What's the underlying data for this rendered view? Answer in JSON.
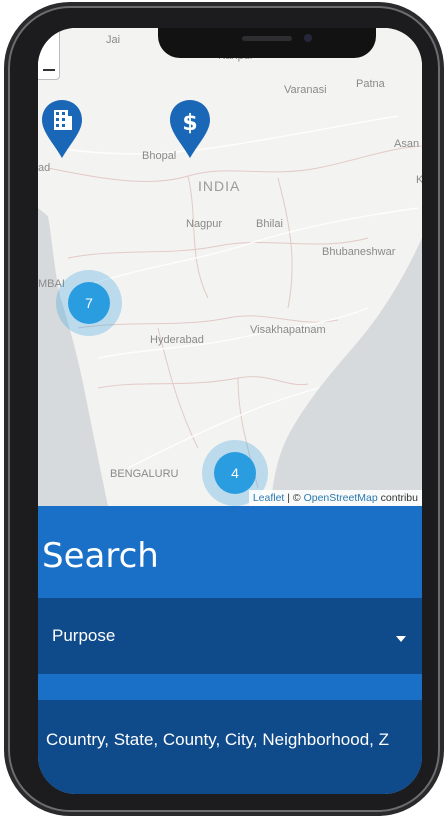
{
  "map": {
    "places": [
      {
        "name": "Jai",
        "kind": "city"
      },
      {
        "name": "Kanpur",
        "kind": "city"
      },
      {
        "name": "Varanasi",
        "kind": "city"
      },
      {
        "name": "Patna",
        "kind": "city"
      },
      {
        "name": "Asan",
        "kind": "city"
      },
      {
        "name": "Bhopal",
        "kind": "city"
      },
      {
        "name": "INDIA",
        "kind": "country"
      },
      {
        "name": "Nagpur",
        "kind": "city"
      },
      {
        "name": "Bhilai",
        "kind": "city"
      },
      {
        "name": "Bhubaneshwar",
        "kind": "city"
      },
      {
        "name": "MBAI",
        "kind": "city"
      },
      {
        "name": "Hyderabad",
        "kind": "city"
      },
      {
        "name": "Visakhapatnam",
        "kind": "city"
      },
      {
        "name": "BENGALURU",
        "kind": "city"
      },
      {
        "name": "ad",
        "kind": "city"
      },
      {
        "name": "K",
        "kind": "city"
      }
    ],
    "markers": [
      {
        "icon": "building-icon",
        "color": "#1a67b8"
      },
      {
        "icon": "dollar-icon",
        "color": "#1a67b8"
      }
    ],
    "clusters": [
      {
        "count": "7"
      },
      {
        "count": "4"
      }
    ],
    "attribution": {
      "leaflet": "Leaflet",
      "separator": " | © ",
      "osm": "OpenStreetMap",
      "suffix": " contribu"
    }
  },
  "search": {
    "title": "Search",
    "purpose_label": "Purpose",
    "location_value": "Country, State, County, City, Neighborhood, Z"
  },
  "colors": {
    "panel": "#1a70c6",
    "field": "#0f4a8a",
    "cluster": "#2a9de0",
    "marker": "#1a67b8"
  }
}
